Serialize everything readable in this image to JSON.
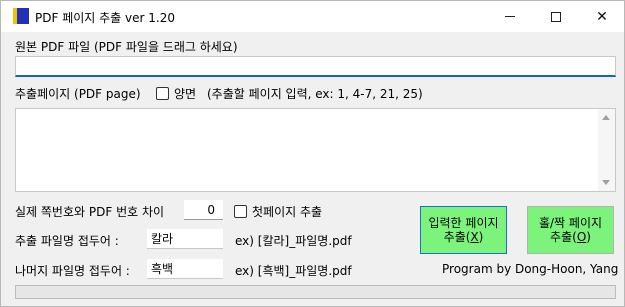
{
  "window": {
    "title": "PDF 페이지 추출 ver 1.20",
    "minimize_glyph": "",
    "close_glyph": "✕"
  },
  "source": {
    "label": "원본 PDF 파일 (PDF 파일을 드래그 하세요)",
    "path_value": ""
  },
  "pages": {
    "label": "추출페이지 (PDF page)",
    "duplex_label": "양면",
    "duplex_checked": false,
    "hint": "(추출할 페이지 입력, ex: 1, 4-7, 21, 25)",
    "value": ""
  },
  "offset": {
    "label": "실제 쪽번호와 PDF 번호 차이",
    "value": "0",
    "first_page_label": "첫페이지 추출",
    "first_page_checked": false
  },
  "prefix": {
    "label": "추출 파일명 접두어 :",
    "value": "칼라",
    "example": "ex) [칼라]_파일명.pdf"
  },
  "rest_prefix": {
    "label": "나머지 파일명 접두어 :",
    "value": "흑백",
    "example": "ex) [흑백]_파일명.pdf"
  },
  "buttons": {
    "extract_line1": "입력한 페이지",
    "extract_line2_pre": "추출(",
    "extract_key": "X",
    "extract_line2_post": ")",
    "oddeven_line1": "홀/짝 페이지",
    "oddeven_line2_pre": "추출(",
    "oddeven_key": "O",
    "oddeven_line2_post": ")",
    "color": "#7cf47c"
  },
  "credit": "Program by Dong-Hoon, Yang",
  "progress": {
    "fraction": 0
  }
}
